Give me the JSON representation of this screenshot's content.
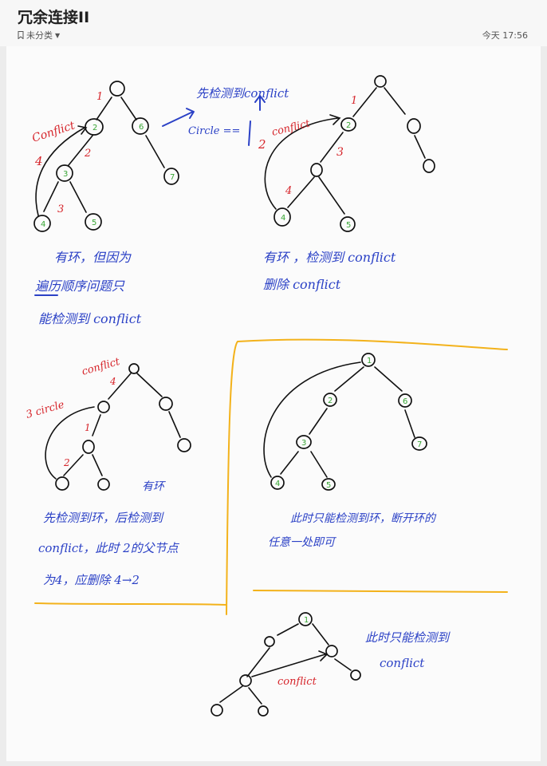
{
  "header": {
    "title": "冗余连接II",
    "category": "未分类",
    "timestamp": "今天 17:56"
  },
  "notes": {
    "top_arrow_text": "先检测到conflict",
    "circle_label": "Circle ==",
    "d1_desc_line1": "有环，但因为",
    "d1_desc_line2": "遍历顺序问题只",
    "d1_desc_line3": "能检测到 conflict",
    "d2_desc_line1": "有环 ，检测到 conflict",
    "d2_desc_line2": "删除 conflict",
    "d3_tag": "有环",
    "d3_desc_line1": "先检测到环，后检测到",
    "d3_desc_line2": "conflict，此时 2的父节点",
    "d3_desc_line3": "为4，应删除 4→2",
    "d4_desc_line1": "此时只能检测到环，断开环的",
    "d4_desc_line2": "任意一处即可",
    "d5_desc_line1": "此时只能检测到",
    "d5_desc_line2": "conflict"
  },
  "red_labels": {
    "conflict_a": "Conflict",
    "conflict_b": "conflict",
    "conflict_c": "conflict",
    "conflict_d": "conflict",
    "circle_c": "3 circle",
    "n1": "1",
    "n2": "2",
    "n3": "3",
    "n4": "4"
  },
  "node_numbers": [
    "1",
    "2",
    "3",
    "4",
    "5",
    "6",
    "7"
  ]
}
